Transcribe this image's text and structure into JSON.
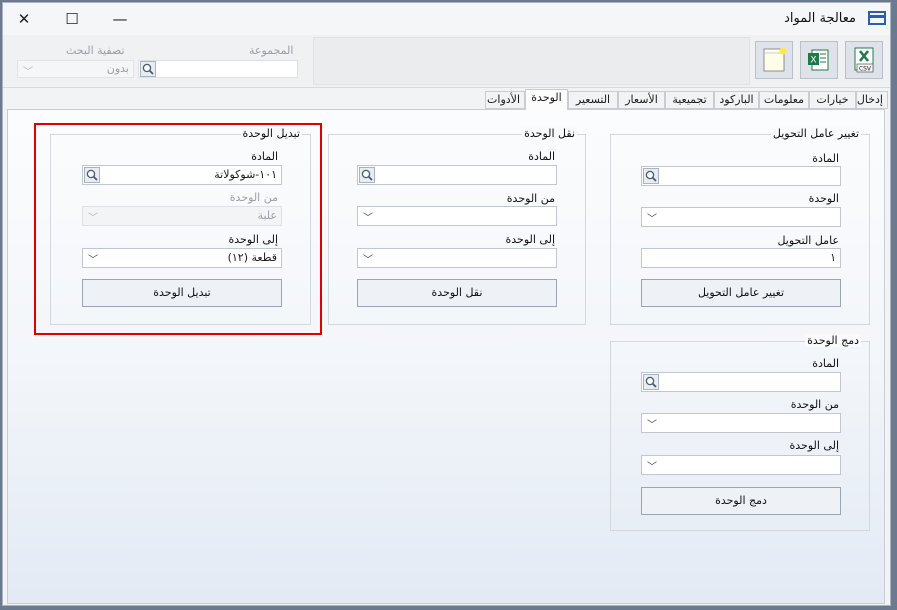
{
  "window": {
    "title": "معالجة المواد",
    "controls": {
      "minimize": "—",
      "maximize": "☐",
      "close": "✕"
    }
  },
  "toolbar": {
    "group_label": "المجموعة",
    "filter_label": "تصفية البحث",
    "filter_value": "بدون",
    "buttons": [
      {
        "name": "csv-export",
        "badge": "CSV"
      },
      {
        "name": "excel-export",
        "badge": "X"
      },
      {
        "name": "new-document",
        "badge": ""
      }
    ]
  },
  "tabs": [
    {
      "label": "إدخال",
      "active": false
    },
    {
      "label": "خيارات",
      "active": false
    },
    {
      "label": "معلومات",
      "active": false
    },
    {
      "label": "الباركود",
      "active": false
    },
    {
      "label": "تجميعية",
      "active": false
    },
    {
      "label": "الأسعار",
      "active": false
    },
    {
      "label": "التسعير",
      "active": false
    },
    {
      "label": "الوحدة",
      "active": true
    },
    {
      "label": "الأدوات",
      "active": false
    }
  ],
  "groups": {
    "change_factor": {
      "title": "تغيير عامل التحويل",
      "material_label": "المادة",
      "unit_label": "الوحدة",
      "factor_label": "عامل التحويل",
      "factor_value": "١",
      "button": "تغيير عامل التحويل"
    },
    "move_unit": {
      "title": "نقل الوحدة",
      "material_label": "المادة",
      "from_label": "من الوحدة",
      "to_label": "إلى الوحدة",
      "button": "نقل الوحدة"
    },
    "swap_unit": {
      "title": "تبديل الوحدة",
      "material_label": "المادة",
      "material_value": "١٠١-شوكولاتة",
      "from_label": "من الوحدة",
      "from_value": "علبة",
      "to_label": "إلى الوحدة",
      "to_value": "قطعة (١٢)",
      "button": "تبديل الوحدة"
    },
    "merge_unit": {
      "title": "دمج الوحدة",
      "material_label": "المادة",
      "from_label": "من الوحدة",
      "to_label": "إلى الوحدة",
      "button": "دمج الوحدة"
    }
  },
  "colors": {
    "highlight": "#e00000",
    "excel_green": "#1e7b45",
    "title_icon": "#2b5fb4"
  }
}
